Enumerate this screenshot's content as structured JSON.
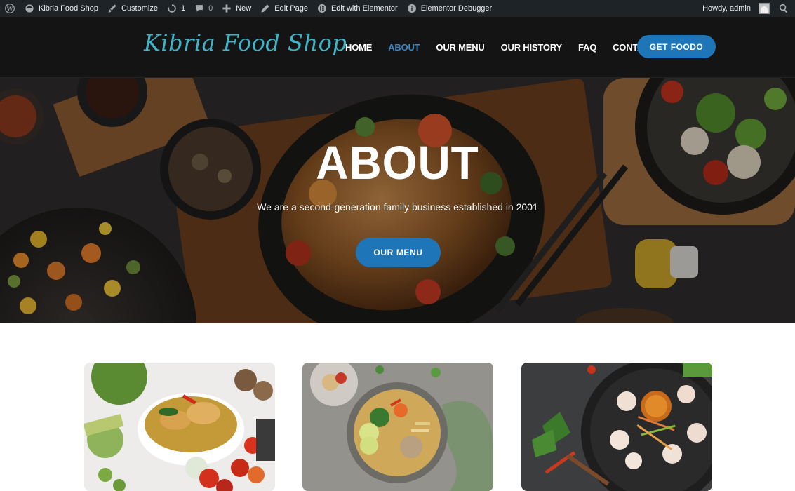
{
  "admin_bar": {
    "left": [
      {
        "icon": "wordpress-logo-icon",
        "label": ""
      },
      {
        "icon": "home-icon",
        "label": "Kibria Food Shop"
      },
      {
        "icon": "brush-icon",
        "label": "Customize"
      },
      {
        "icon": "updates-icon",
        "label": "1"
      },
      {
        "icon": "comment-icon",
        "label": "0"
      },
      {
        "icon": "plus-icon",
        "label": "New"
      },
      {
        "icon": "pencil-icon",
        "label": "Edit Page"
      },
      {
        "icon": "elementor-icon",
        "label": "Edit with Elementor"
      },
      {
        "icon": "info-icon",
        "label": "Elementor Debugger"
      }
    ],
    "greeting": "Howdy, admin",
    "search_icon": "search-icon"
  },
  "header": {
    "logo_text": "Kibria Food Shop",
    "nav": [
      {
        "label": "HOME",
        "active": false
      },
      {
        "label": "ABOUT",
        "active": true
      },
      {
        "label": "OUR MENU",
        "active": false
      },
      {
        "label": "OUR HISTORY",
        "active": false
      },
      {
        "label": "FAQ",
        "active": false
      },
      {
        "label": "CONTACT US",
        "active": false
      }
    ],
    "cta_label": "GET FOODO"
  },
  "hero": {
    "title": "ABOUT",
    "subtitle": "We are a second-generation family business established in 2001",
    "button_label": "OUR MENU"
  },
  "cards": [
    {
      "image": "curry-bowl-photo"
    },
    {
      "image": "noodle-soup-photo"
    },
    {
      "image": "shrimp-platter-photo"
    }
  ],
  "colors": {
    "accent": "#1e75b8",
    "nav_active": "#3d86c6",
    "logo": "#3fb4c9",
    "header_bg": "#141414",
    "admin_bar_bg": "#1d2327"
  }
}
